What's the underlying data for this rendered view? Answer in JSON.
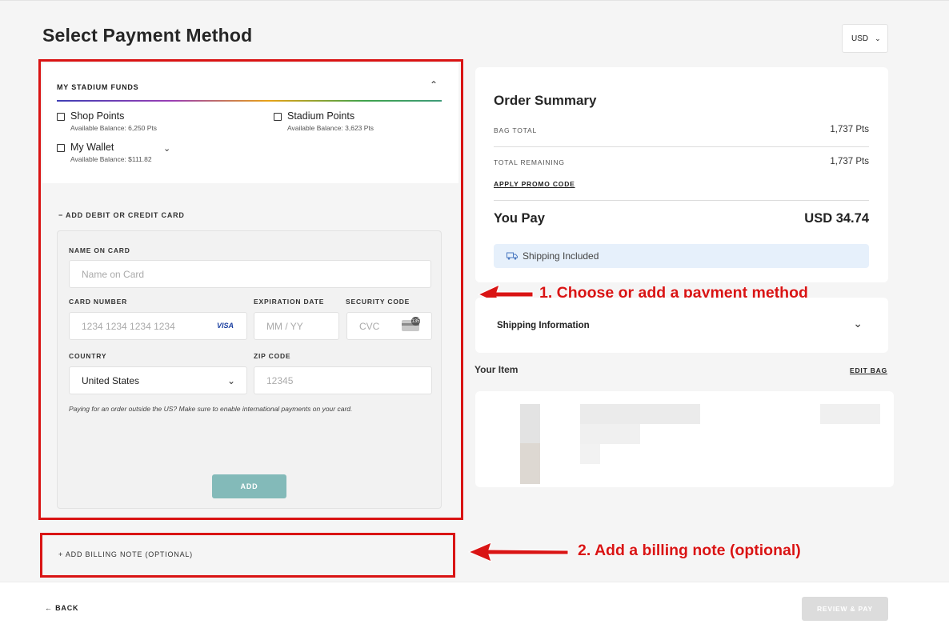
{
  "header": {
    "title": "Select Payment Method",
    "currency": "USD"
  },
  "funds": {
    "title": "MY STADIUM FUNDS",
    "items": [
      {
        "name": "Shop Points",
        "balance": "Available Balance: 6,250 Pts"
      },
      {
        "name": "Stadium Points",
        "balance": "Available Balance: 3,623 Pts"
      },
      {
        "name": "My Wallet",
        "balance": "Available Balance: $111.82"
      }
    ]
  },
  "card_form": {
    "toggle_label": "−  ADD DEBIT OR CREDIT CARD",
    "name_label": "NAME ON CARD",
    "name_placeholder": "Name on Card",
    "number_label": "CARD NUMBER",
    "number_placeholder": "1234 1234 1234 1234",
    "card_brand": "VISA",
    "expiry_label": "EXPIRATION DATE",
    "expiry_placeholder": "MM / YY",
    "cvc_label": "SECURITY CODE",
    "cvc_placeholder": "CVC",
    "cvc_icon_number": "135",
    "country_label": "COUNTRY",
    "country_value": "United States",
    "zip_label": "ZIP CODE",
    "zip_placeholder": "12345",
    "note": "Paying for an order outside the US? Make sure to enable international payments on your card.",
    "add_button": "ADD"
  },
  "billing": {
    "label": "+  ADD BILLING NOTE (OPTIONAL)"
  },
  "annotations": {
    "step1": "1. Choose or add a payment method",
    "step2": "2. Add a billing note (optional)",
    "color": "#d91414"
  },
  "summary": {
    "title": "Order Summary",
    "bag_total_label": "BAG TOTAL",
    "bag_total_value": "1,737 Pts",
    "remaining_label": "TOTAL REMAINING",
    "remaining_value": "1,737 Pts",
    "promo_link": "APPLY PROMO CODE",
    "you_pay_label": "You Pay",
    "you_pay_value": "USD 34.74",
    "shipping_badge": "Shipping Included"
  },
  "shipping_info": {
    "label": "Shipping Information"
  },
  "item": {
    "title": "Your Item",
    "edit_link": "EDIT BAG"
  },
  "footer": {
    "back": "←  BACK",
    "review": "REVIEW & PAY"
  },
  "colors": {
    "accent_button": "#83bab9",
    "disabled_button": "#dcdcdc",
    "shipping_bg": "#e6f0fb"
  }
}
